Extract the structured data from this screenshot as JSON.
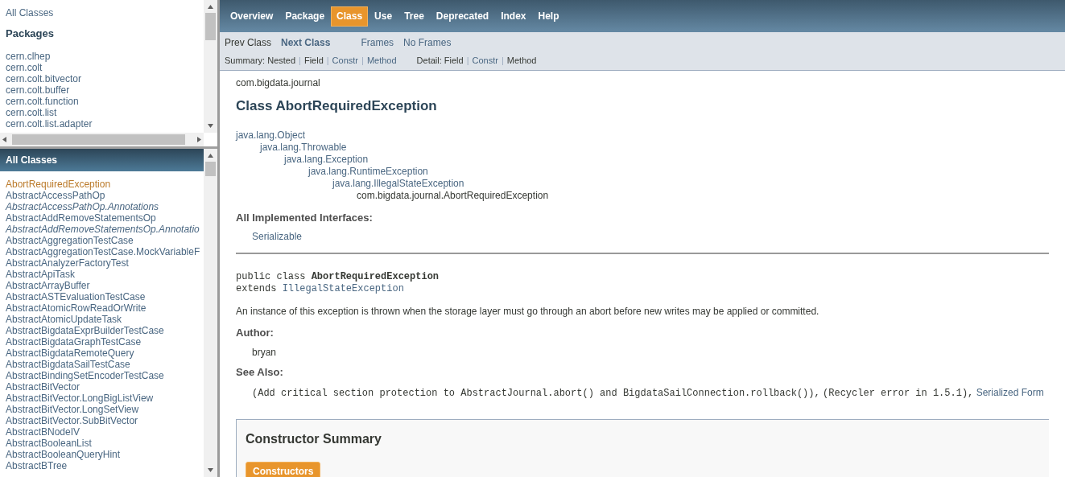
{
  "left_frame": {
    "top_pane": {
      "all_classes_link": "All Classes",
      "heading": "Packages",
      "packages": [
        "cern.clhep",
        "cern.colt",
        "cern.colt.bitvector",
        "cern.colt.buffer",
        "cern.colt.function",
        "cern.colt.list",
        "cern.colt.list.adapter"
      ]
    },
    "bottom_pane": {
      "heading": "All Classes",
      "classes": [
        {
          "name": "AbortRequiredException",
          "kind": "class",
          "selected": true
        },
        {
          "name": "AbstractAccessPathOp",
          "kind": "class",
          "selected": false
        },
        {
          "name": "AbstractAccessPathOp.Annotations",
          "kind": "interface",
          "selected": false
        },
        {
          "name": "AbstractAddRemoveStatementsOp",
          "kind": "class",
          "selected": false
        },
        {
          "name": "AbstractAddRemoveStatementsOp.Annotatio",
          "kind": "interface",
          "selected": false
        },
        {
          "name": "AbstractAggregationTestCase",
          "kind": "class",
          "selected": false
        },
        {
          "name": "AbstractAggregationTestCase.MockVariableF",
          "kind": "class",
          "selected": false
        },
        {
          "name": "AbstractAnalyzerFactoryTest",
          "kind": "class",
          "selected": false
        },
        {
          "name": "AbstractApiTask",
          "kind": "class",
          "selected": false
        },
        {
          "name": "AbstractArrayBuffer",
          "kind": "class",
          "selected": false
        },
        {
          "name": "AbstractASTEvaluationTestCase",
          "kind": "class",
          "selected": false
        },
        {
          "name": "AbstractAtomicRowReadOrWrite",
          "kind": "class",
          "selected": false
        },
        {
          "name": "AbstractAtomicUpdateTask",
          "kind": "class",
          "selected": false
        },
        {
          "name": "AbstractBigdataExprBuilderTestCase",
          "kind": "class",
          "selected": false
        },
        {
          "name": "AbstractBigdataGraphTestCase",
          "kind": "class",
          "selected": false
        },
        {
          "name": "AbstractBigdataRemoteQuery",
          "kind": "class",
          "selected": false
        },
        {
          "name": "AbstractBigdataSailTestCase",
          "kind": "class",
          "selected": false
        },
        {
          "name": "AbstractBindingSetEncoderTestCase",
          "kind": "class",
          "selected": false
        },
        {
          "name": "AbstractBitVector",
          "kind": "class",
          "selected": false
        },
        {
          "name": "AbstractBitVector.LongBigListView",
          "kind": "class",
          "selected": false
        },
        {
          "name": "AbstractBitVector.LongSetView",
          "kind": "class",
          "selected": false
        },
        {
          "name": "AbstractBitVector.SubBitVector",
          "kind": "class",
          "selected": false
        },
        {
          "name": "AbstractBNodeIV",
          "kind": "class",
          "selected": false
        },
        {
          "name": "AbstractBooleanList",
          "kind": "class",
          "selected": false
        },
        {
          "name": "AbstractBooleanQueryHint",
          "kind": "class",
          "selected": false
        },
        {
          "name": "AbstractBTree",
          "kind": "class",
          "selected": false
        }
      ]
    }
  },
  "top_nav": [
    {
      "label": "Overview",
      "selected": false
    },
    {
      "label": "Package",
      "selected": false
    },
    {
      "label": "Class",
      "selected": true
    },
    {
      "label": "Use",
      "selected": false
    },
    {
      "label": "Tree",
      "selected": false
    },
    {
      "label": "Deprecated",
      "selected": false
    },
    {
      "label": "Index",
      "selected": false
    },
    {
      "label": "Help",
      "selected": false
    }
  ],
  "sub_nav": {
    "class_links": [
      {
        "label": "Prev Class",
        "kind": "plain"
      },
      {
        "label": "Next Class",
        "kind": "bold"
      }
    ],
    "frame_links": [
      {
        "label": "Frames",
        "kind": "link"
      },
      {
        "label": "No Frames",
        "kind": "link"
      }
    ],
    "summary": {
      "label": "Summary:",
      "separator": "|",
      "items": [
        {
          "label": "Nested",
          "link": false
        },
        {
          "label": "Field",
          "link": false
        },
        {
          "label": "Constr",
          "link": true
        },
        {
          "label": "Method",
          "link": true
        }
      ]
    },
    "detail": {
      "label": "Detail:",
      "separator": "|",
      "items": [
        {
          "label": "Field",
          "link": false
        },
        {
          "label": "Constr",
          "link": true
        },
        {
          "label": "Method",
          "link": false
        }
      ]
    }
  },
  "content": {
    "package": "com.bigdata.journal",
    "title": "Class AbortRequiredException",
    "inheritance": {
      "name": "java.lang.Object",
      "link": true,
      "children": [
        {
          "name": "java.lang.Throwable",
          "link": true,
          "children": [
            {
              "name": "java.lang.Exception",
              "link": true,
              "children": [
                {
                  "name": "java.lang.RuntimeException",
                  "link": true,
                  "children": [
                    {
                      "name": "java.lang.IllegalStateException",
                      "link": true,
                      "children": [
                        {
                          "name": "com.bigdata.journal.AbortRequiredException",
                          "link": false
                        }
                      ]
                    }
                  ]
                }
              ]
            }
          ]
        }
      ]
    },
    "interfaces_heading": "All Implemented Interfaces:",
    "interfaces": [
      "Serializable"
    ],
    "declaration": {
      "line1": "public class **AbortRequiredException**",
      "extends_word": "extends",
      "extends_link": "IllegalStateException"
    },
    "description": "An instance of this exception is thrown when the storage layer must go through an abort before new writes may be applied or committed.",
    "author_heading": "Author:",
    "author": "bryan",
    "see_also_heading": "See Also:",
    "see_also": [
      {
        "text": "(Add critical section protection to AbstractJournal.abort() and BigdataSailConnection.rollback()),",
        "kind": "code"
      },
      {
        "text": "(Recycler error in 1.5.1),",
        "kind": "code"
      },
      {
        "text": "Serialized Form",
        "kind": "link"
      }
    ],
    "constructor_summary": {
      "heading": "Constructor Summary",
      "tab": "Constructors"
    }
  }
}
